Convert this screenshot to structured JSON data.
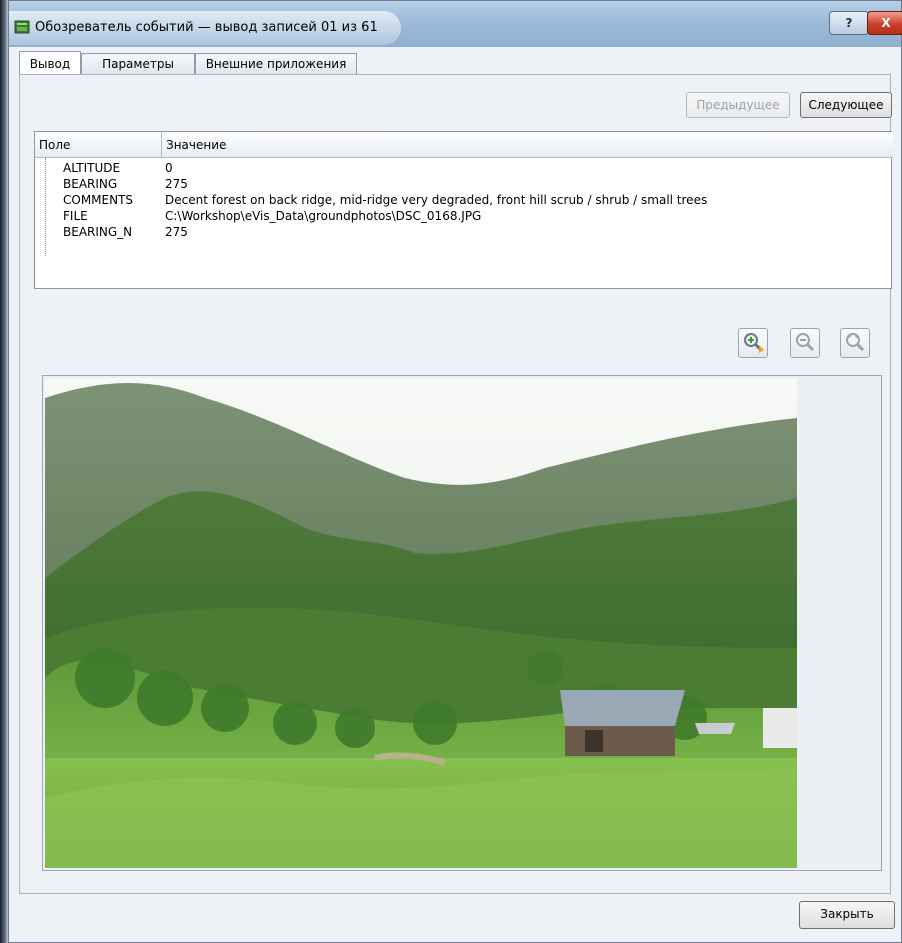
{
  "window": {
    "title": "Обозреватель событий — вывод записей 01 из 61",
    "help_label": "?",
    "close_label": "X"
  },
  "tabs": [
    {
      "label": "Вывод",
      "active": true
    },
    {
      "label": "Параметры",
      "active": false
    },
    {
      "label": "Внешние приложения",
      "active": false
    }
  ],
  "navigation": {
    "previous_label": "Предыдущее",
    "previous_enabled": false,
    "next_label": "Следующее"
  },
  "attribute_table": {
    "columns": [
      "Поле",
      "Значение"
    ],
    "rows": [
      {
        "field": "ALTITUDE",
        "value": "0"
      },
      {
        "field": "BEARING",
        "value": "275"
      },
      {
        "field": "COMMENTS",
        "value": "Decent forest on back ridge, mid-ridge very degraded, front hill scrub / shrub / small trees"
      },
      {
        "field": "FILE",
        "value": "C:\\Workshop\\eVis_Data\\groundphotos\\DSC_0168.JPG"
      },
      {
        "field": "BEARING_N",
        "value": "275"
      }
    ]
  },
  "zoom_toolbar": {
    "icons": [
      "zoom-in-icon",
      "zoom-out-icon",
      "zoom-full-icon"
    ]
  },
  "photo": {
    "subject": "forested mountain ridge with hut"
  },
  "footer": {
    "close_label": "Закрыть"
  }
}
